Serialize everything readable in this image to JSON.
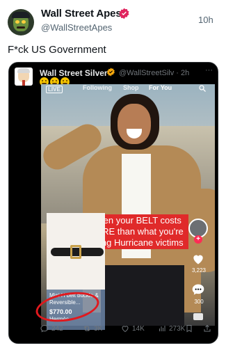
{
  "post": {
    "author_name": "Wall Street Apes",
    "author_handle": "@WallStreetApes",
    "timestamp": "10h",
    "text": "F*ck US Government",
    "verified_color": "#e0245e"
  },
  "quote": {
    "author_name": "Wall Street Silver",
    "author_handle": "@WallStreetSilv · 2h",
    "more": "···",
    "verified_color": "#f4a70d",
    "emojis": [
      "grimace",
      "grimace",
      "grimace"
    ],
    "video": {
      "tabs": {
        "live": "LIVE",
        "following": "Following",
        "shop": "Shop",
        "for_you": "For You"
      },
      "caption": "When your BELT costs MORE than what you're giving Hurricane victims",
      "product": {
        "name": "Mini H belt buckle & Reversible...",
        "price": "$770.00",
        "brand": "Hermès"
      },
      "side": {
        "likes": "3,223",
        "comments": "300"
      }
    },
    "actions": {
      "replies": "242",
      "retweets": "3K",
      "likes": "14K",
      "views": "273K"
    }
  }
}
